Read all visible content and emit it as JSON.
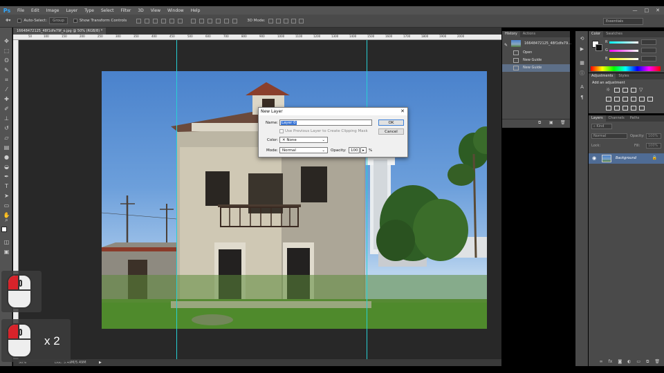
{
  "app": {
    "logo": "Ps"
  },
  "menu": [
    "File",
    "Edit",
    "Image",
    "Layer",
    "Type",
    "Select",
    "Filter",
    "3D",
    "View",
    "Window",
    "Help"
  ],
  "window_controls": [
    "—",
    "□",
    "✕"
  ],
  "options_bar": {
    "auto_select_label": "Auto-Select:",
    "auto_select_value": "Group",
    "show_transform_label": "Show Transform Controls",
    "mode_3d_label": "3D Mode:",
    "workspace": "Essentials"
  },
  "document": {
    "tab_title": "16648472125_48f1dfe79f_o.jpg @ 50% (RGB/8) *",
    "ruler_ticks": [
      "50",
      "100",
      "150",
      "200",
      "250",
      "300",
      "350",
      "400",
      "450",
      "500",
      "600",
      "700",
      "800",
      "900",
      "1000",
      "1100",
      "1200",
      "1300",
      "1400",
      "1500",
      "1600",
      "1700",
      "1800",
      "1900",
      "2000"
    ],
    "zoom": "50%",
    "doc_size": "Doc: 5.49M/5.49M"
  },
  "dialog": {
    "title": "New Layer",
    "name_label": "Name:",
    "name_value": "Layer 0",
    "clipping_label": "Use Previous Layer to Create Clipping Mask",
    "color_label": "Color:",
    "color_value": "None",
    "mode_label": "Mode:",
    "mode_value": "Normal",
    "opacity_label": "Opacity:",
    "opacity_value": "100",
    "opacity_unit": "%",
    "ok_label": "OK",
    "cancel_label": "Cancel"
  },
  "mouse_overlay": {
    "count_label": "x 2"
  },
  "history": {
    "tabs": [
      "History",
      "Actions"
    ],
    "snapshot": "16648472125_48f1dfe79...",
    "items": [
      "Open",
      "New Guide",
      "New Guide"
    ]
  },
  "color_panel": {
    "tabs": [
      "Color",
      "Swatches"
    ],
    "channels": [
      "R",
      "G",
      "B"
    ]
  },
  "adjustments": {
    "tabs": [
      "Adjustments",
      "Styles"
    ],
    "heading": "Add an adjustment"
  },
  "layers": {
    "tabs": [
      "Layers",
      "Channels",
      "Paths"
    ],
    "kind": "Kind",
    "blend_mode": "Normal",
    "opacity_label": "Opacity:",
    "opacity_value": "100%",
    "lock_label": "Lock:",
    "fill_label": "Fill:",
    "fill_value": "100%",
    "layer_name": "Background"
  },
  "colors": {
    "guide": "#27d0d4",
    "accent": "#31a8ff",
    "selection": "#3875d7",
    "mouse_red": "#d8232a"
  }
}
